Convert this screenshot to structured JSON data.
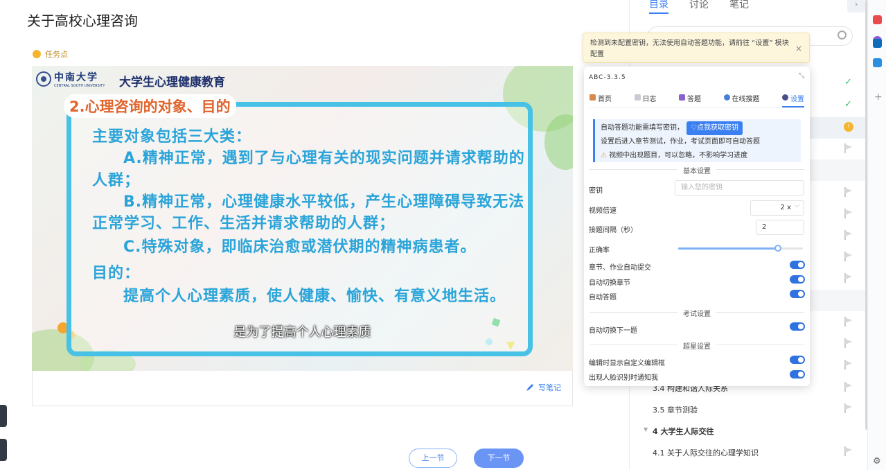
{
  "page": {
    "title": "关于高校心理咨询",
    "task_point": "任务点"
  },
  "video": {
    "university_cn": "中南大学",
    "university_en": "CENTRAL SOUTH UNIVERSITY",
    "course": "大学生心理健康教育",
    "slide_heading": "2.心理咨询的对象、目的",
    "slide_lines": [
      "主要对象包括三大类：",
      "A.精神正常，遇到了与心理有关的现实问题并请求帮助的",
      "人群；",
      "B.精神正常，心理健康水平较低，产生心理障碍导致无法",
      "正常学习、工作、生活并请求帮助的人群；",
      "C.特殊对象，即临床治愈或潜伏期的精神病患者。",
      "目的：",
      "提高个人心理素质，使人健康、愉快、有意义地生活。"
    ],
    "subtitle": "是为了提高个人心理素质"
  },
  "notes": {
    "write_note": "写笔记"
  },
  "nav": {
    "prev": "上一节",
    "next": "下一节"
  },
  "sidebar": {
    "tabs": [
      "目录",
      "讨论",
      "笔记"
    ],
    "rows": [
      {
        "label": "...",
        "status": "check"
      },
      {
        "label": "",
        "status": "check"
      },
      {
        "label": "",
        "status": "pending",
        "pending_text": "!"
      },
      {
        "label": "",
        "status": "flag"
      },
      {
        "label": "",
        "status": "flag"
      },
      {
        "label": "",
        "status": "flag"
      },
      {
        "label": "",
        "status": "flag"
      },
      {
        "label": "",
        "status": "flag"
      },
      {
        "label": "",
        "status": "flag"
      },
      {
        "label": "",
        "status": "flag"
      },
      {
        "label": "",
        "status": "flag"
      },
      {
        "label": "3.4 构建和谐人际关系",
        "status": "flag"
      },
      {
        "label": "3.5 章节测验",
        "status": "flag"
      },
      {
        "label": "4 大学生人际交往",
        "status": "section"
      },
      {
        "label": "4.1 关于人际交往的心理学知识",
        "status": "flag"
      }
    ]
  },
  "toast": {
    "text": "检测到未配置密钥，无法使用自动答题功能，请前往 “设置” 模块配置",
    "close": "×"
  },
  "panel": {
    "version": "ABC-3.3.5",
    "tabs": [
      "首页",
      "日志",
      "答题",
      "在线搜题",
      "设置"
    ],
    "active_tab": "设置",
    "info_line1": "自动答题功能需填写密钥，",
    "get_key_button": "点我获取密钥",
    "info_line2": "设置后进入章节测试，作业，考试页面即可自动答题",
    "info_line3": "视频中出现题目，可以忽略，不影响学习进度",
    "basic_settings": "基本设置",
    "key_label": "密钥",
    "key_placeholder": "输入您的密钥",
    "speed_label": "视频倍速",
    "speed_value": "2 x",
    "interval_label": "接题间隔（秒）",
    "interval_value": "2",
    "accuracy_label": "正确率",
    "accuracy_value": 0.8,
    "auto_submit_label": "章节、作业自动提交",
    "auto_switch_chapter_label": "自动切换章节",
    "auto_answer_label": "自动答题",
    "exam_settings": "考试设置",
    "auto_next_label": "自动切换下一题",
    "star_settings": "超星设置",
    "custom_editor_label": "编辑时显示自定义编辑框",
    "face_notify_label": "出现人脸识别时通知我"
  },
  "colors": {
    "accent": "#3b7ff0",
    "toast_bg": "#fdf6dd",
    "slide_text": "#2aa4d9",
    "slide_heading": "#e0642c",
    "success": "#3cbf6a",
    "pending": "#f5b52c"
  }
}
